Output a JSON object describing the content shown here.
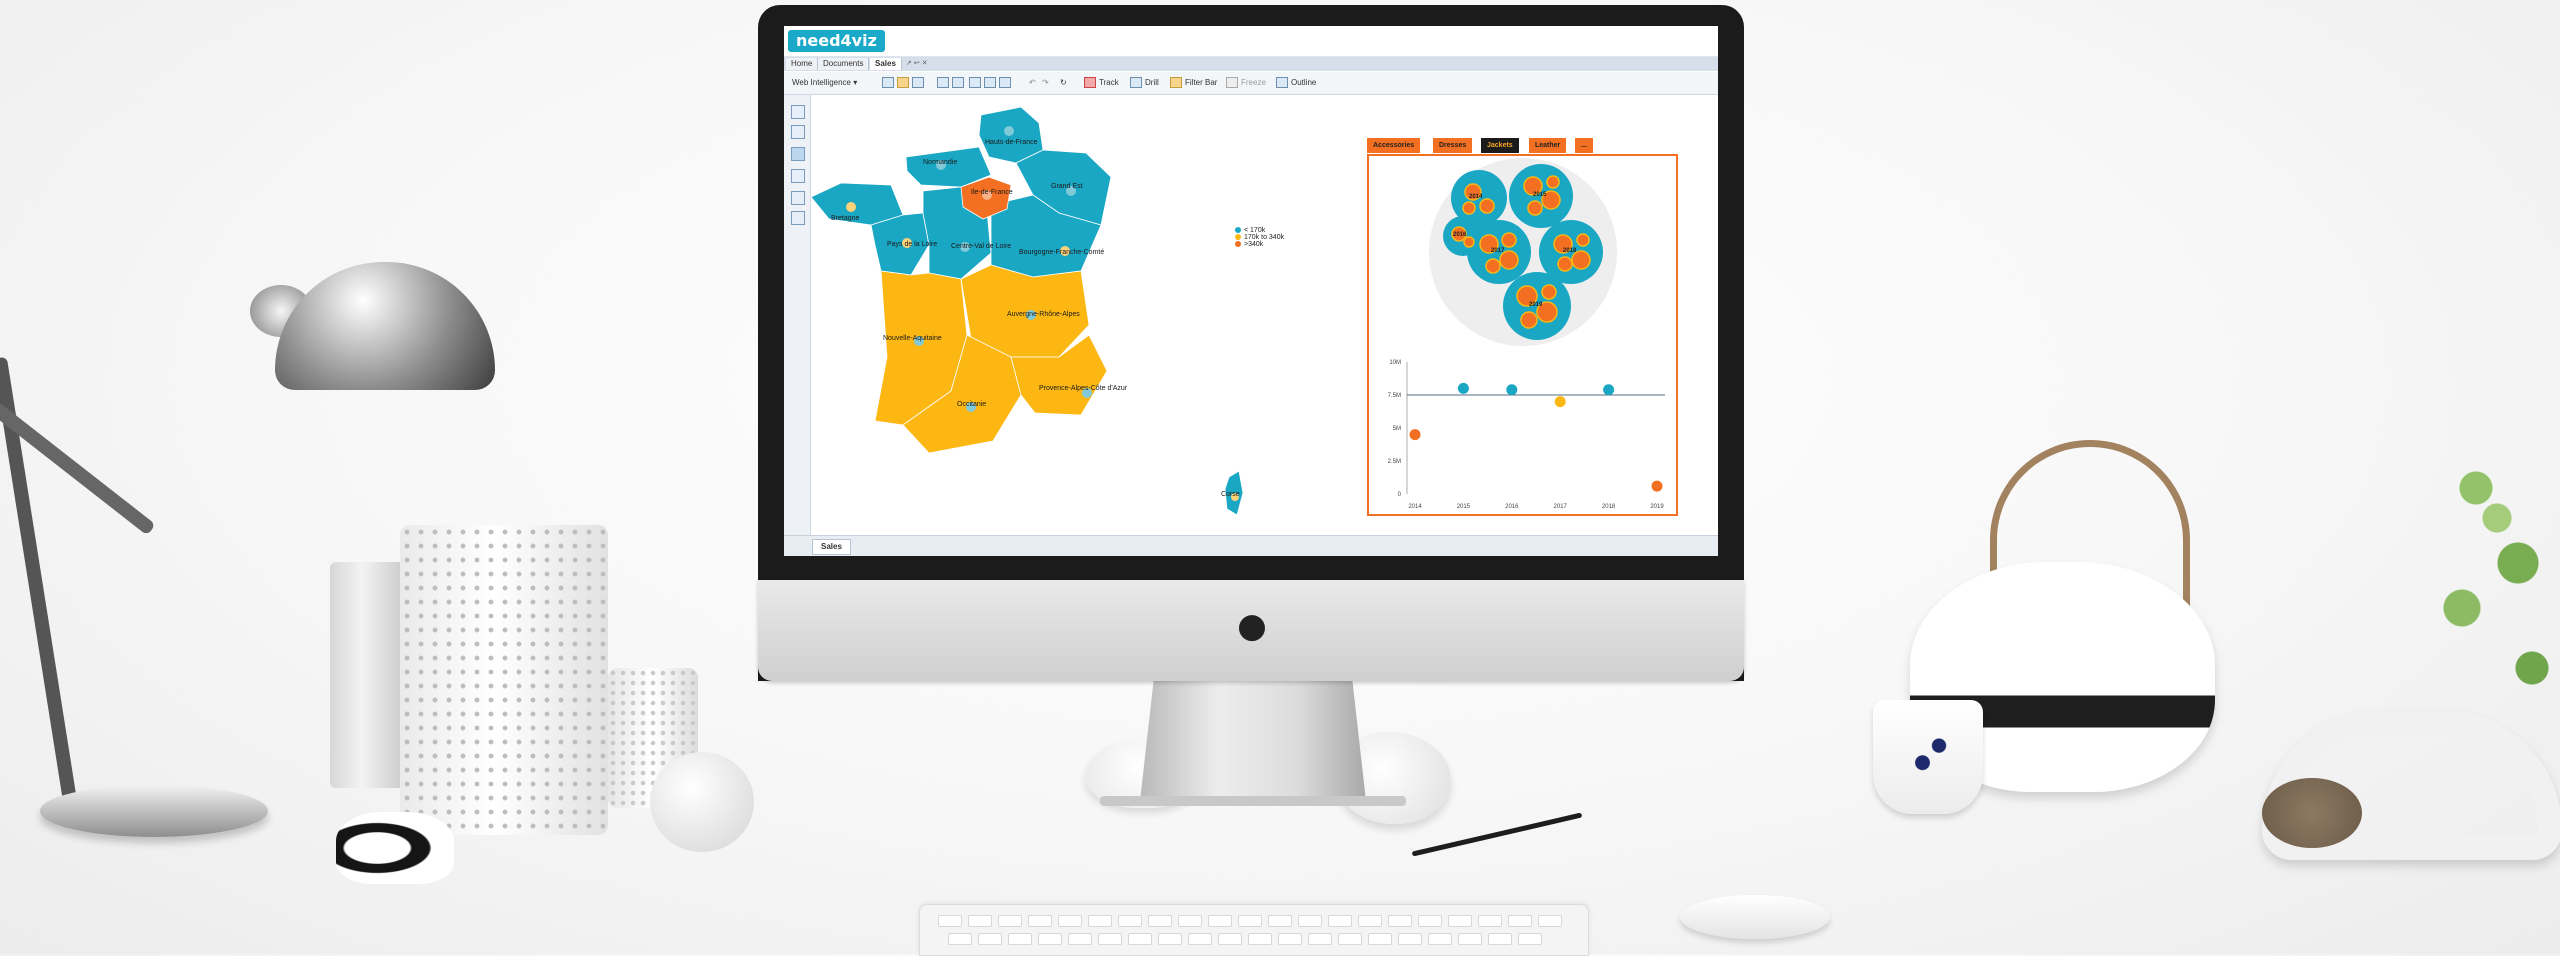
{
  "app": {
    "logo_text": "need4viz",
    "doc_tabs": [
      {
        "label": "Home"
      },
      {
        "label": "Documents"
      },
      {
        "label": "Sales"
      }
    ],
    "toolbar": {
      "mode": "Web Intelligence",
      "track": "Track",
      "drill": "Drill",
      "filter_bar": "Filter Bar",
      "freeze": "Freeze",
      "outline": "Outline"
    },
    "sheet_tab": "Sales"
  },
  "map": {
    "colors": {
      "teal": "#1aa7c4",
      "yellow": "#fcb713",
      "orange": "#f36f21"
    },
    "regions": [
      {
        "name": "Hauts-de-France",
        "band": "< 170k"
      },
      {
        "name": "Normandie",
        "band": "< 170k"
      },
      {
        "name": "Ile-de-France",
        "band": ">340k"
      },
      {
        "name": "Grand Est",
        "band": "< 170k"
      },
      {
        "name": "Bretagne",
        "band": "< 170k"
      },
      {
        "name": "Pays de la Loire",
        "band": "< 170k"
      },
      {
        "name": "Centre-Val de Loire",
        "band": "< 170k"
      },
      {
        "name": "Bourgogne-Franche-Comté",
        "band": "< 170k"
      },
      {
        "name": "Nouvelle-Aquitaine",
        "band": "170k to 340k"
      },
      {
        "name": "Auvergne-Rhône-Alpes",
        "band": "170k to 340k"
      },
      {
        "name": "Occitanie",
        "band": "170k to 340k"
      },
      {
        "name": "Provence-Alpes-Côte d'Azur",
        "band": "170k to 340k"
      },
      {
        "name": "Corse",
        "band": "< 170k"
      }
    ],
    "legend": [
      {
        "label": "< 170k",
        "color": "#1aa7c4"
      },
      {
        "label": "170k to 340k",
        "color": "#fcb713"
      },
      {
        "label": ">340k",
        "color": "#f36f21"
      }
    ]
  },
  "panel": {
    "tabs": [
      "Accessories",
      "Dresses",
      "Jackets",
      "Leather",
      "..."
    ],
    "active_tab": "Jackets",
    "bubble_labels": [
      "2014",
      "2015",
      "2016",
      "2017",
      "2018",
      "2019"
    ]
  },
  "chart_data": {
    "type": "scatter",
    "title": "",
    "xlabel": "",
    "ylabel": "",
    "x": [
      2014,
      2015,
      2016,
      2017,
      2018,
      2019
    ],
    "values": [
      4.5,
      8.0,
      7.9,
      7.0,
      7.9,
      0.6
    ],
    "point_colors": [
      "#f36f21",
      "#1aa7c4",
      "#1aa7c4",
      "#fcb713",
      "#1aa7c4",
      "#f36f21"
    ],
    "reference_line": 7.5,
    "yticks": [
      "0",
      "2.5M",
      "5M",
      "7.5M",
      "10M"
    ],
    "xticks": [
      "2014",
      "2015",
      "2016",
      "2017",
      "2018",
      "2019"
    ],
    "ylim": [
      0,
      10
    ],
    "grid": false
  }
}
